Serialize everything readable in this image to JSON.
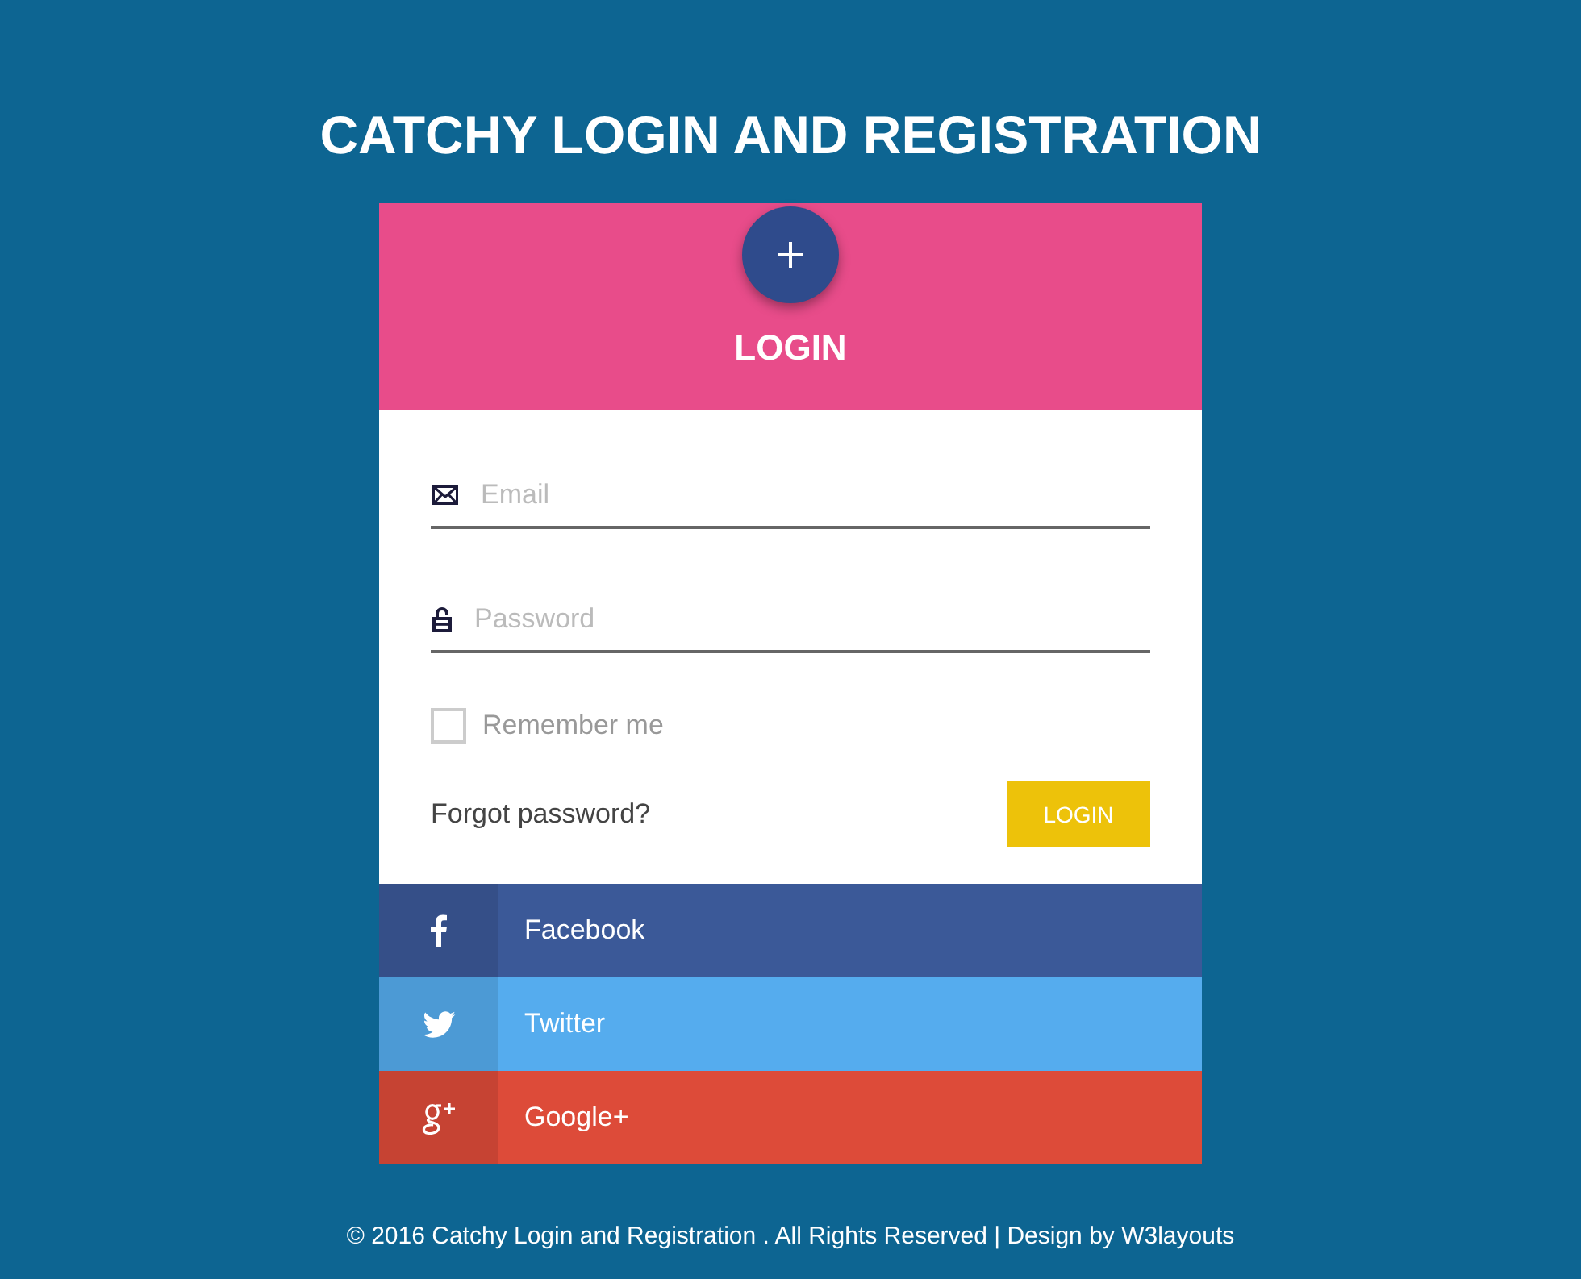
{
  "page": {
    "title": "CATCHY LOGIN AND REGISTRATION"
  },
  "card": {
    "header": {
      "title": "LOGIN"
    },
    "fields": [
      {
        "kind": "email",
        "placeholder": "Email"
      },
      {
        "kind": "password",
        "placeholder": "Password"
      }
    ],
    "remember": {
      "label": "Remember me",
      "checked": false
    },
    "forgot_link": "Forgot password?",
    "submit_button": "LOGIN"
  },
  "social_buttons": [
    {
      "kind": "facebook",
      "label": "Facebook",
      "color": "#3b5998"
    },
    {
      "kind": "twitter",
      "label": "Twitter",
      "color": "#55acee"
    },
    {
      "kind": "google",
      "label": "Google+",
      "color": "#dd4b39"
    }
  ],
  "footer": "© 2016 Catchy Login and Registration . All Rights Reserved | Design by W3layouts"
}
